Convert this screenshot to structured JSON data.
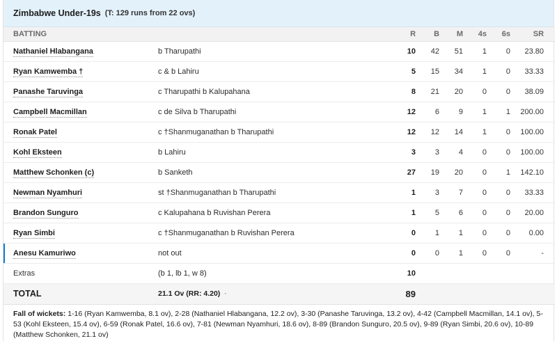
{
  "team": {
    "name": "Zimbabwe Under-19s",
    "target": "(T: 129 runs from 22 ovs)"
  },
  "columns": {
    "batting": "BATTING",
    "r": "R",
    "b": "B",
    "m": "M",
    "fours": "4s",
    "sixes": "6s",
    "sr": "SR"
  },
  "batters": [
    {
      "name": "Nathaniel Hlabangana",
      "dismissal": "b Tharupathi",
      "r": "10",
      "b": "42",
      "m": "51",
      "fours": "1",
      "sixes": "0",
      "sr": "23.80"
    },
    {
      "name": "Ryan Kamwemba †",
      "dismissal": "c & b Lahiru",
      "r": "5",
      "b": "15",
      "m": "34",
      "fours": "1",
      "sixes": "0",
      "sr": "33.33"
    },
    {
      "name": "Panashe Taruvinga",
      "dismissal": "c Tharupathi b Kalupahana",
      "r": "8",
      "b": "21",
      "m": "20",
      "fours": "0",
      "sixes": "0",
      "sr": "38.09"
    },
    {
      "name": "Campbell Macmillan",
      "dismissal": "c de Silva b Tharupathi",
      "r": "12",
      "b": "6",
      "m": "9",
      "fours": "1",
      "sixes": "1",
      "sr": "200.00"
    },
    {
      "name": "Ronak Patel",
      "dismissal": "c †Shanmuganathan b Tharupathi",
      "r": "12",
      "b": "12",
      "m": "14",
      "fours": "1",
      "sixes": "0",
      "sr": "100.00"
    },
    {
      "name": "Kohl Eksteen",
      "dismissal": "b Lahiru",
      "r": "3",
      "b": "3",
      "m": "4",
      "fours": "0",
      "sixes": "0",
      "sr": "100.00"
    },
    {
      "name": "Matthew Schonken (c)",
      "dismissal": "b Sanketh",
      "r": "27",
      "b": "19",
      "m": "20",
      "fours": "0",
      "sixes": "1",
      "sr": "142.10"
    },
    {
      "name": "Newman Nyamhuri",
      "dismissal": "st †Shanmuganathan b Tharupathi",
      "r": "1",
      "b": "3",
      "m": "7",
      "fours": "0",
      "sixes": "0",
      "sr": "33.33"
    },
    {
      "name": "Brandon Sunguro",
      "dismissal": "c Kalupahana b Ruvishan Perera",
      "r": "1",
      "b": "5",
      "m": "6",
      "fours": "0",
      "sixes": "0",
      "sr": "20.00"
    },
    {
      "name": "Ryan Simbi",
      "dismissal": "c †Shanmuganathan b Ruvishan Perera",
      "r": "0",
      "b": "1",
      "m": "1",
      "fours": "0",
      "sixes": "0",
      "sr": "0.00"
    },
    {
      "name": "Anesu Kamuriwo",
      "dismissal": "not out",
      "r": "0",
      "b": "0",
      "m": "1",
      "fours": "0",
      "sixes": "0",
      "sr": "-"
    }
  ],
  "extras": {
    "label": "Extras",
    "detail": "(b 1, lb 1, w 8)",
    "runs": "10"
  },
  "total": {
    "label": "TOTAL",
    "overs": "21.1 Ov (RR: 4.20)",
    "separator": "·",
    "runs": "89"
  },
  "fall_of_wickets": {
    "label": "Fall of wickets:",
    "text": "1-16 (Ryan Kamwemba, 8.1 ov), 2-28 (Nathaniel Hlabangana, 12.2 ov), 3-30 (Panashe Taruvinga, 13.2 ov), 4-42 (Campbell Macmillan, 14.1 ov), 5-53 (Kohl Eksteen, 15.4 ov), 6-59 (Ronak Patel, 16.6 ov), 7-81 (Newman Nyamhuri, 18.6 ov), 8-89 (Brandon Sunguro, 20.5 ov), 9-89 (Ryan Simbi, 20.6 ov), 10-89 (Matthew Schonken, 21.1 ov)"
  },
  "colors": {
    "header_bg": "#e3f1fb",
    "active_marker": "#0c7bd6",
    "column_header_bg": "#f2f2f2"
  }
}
